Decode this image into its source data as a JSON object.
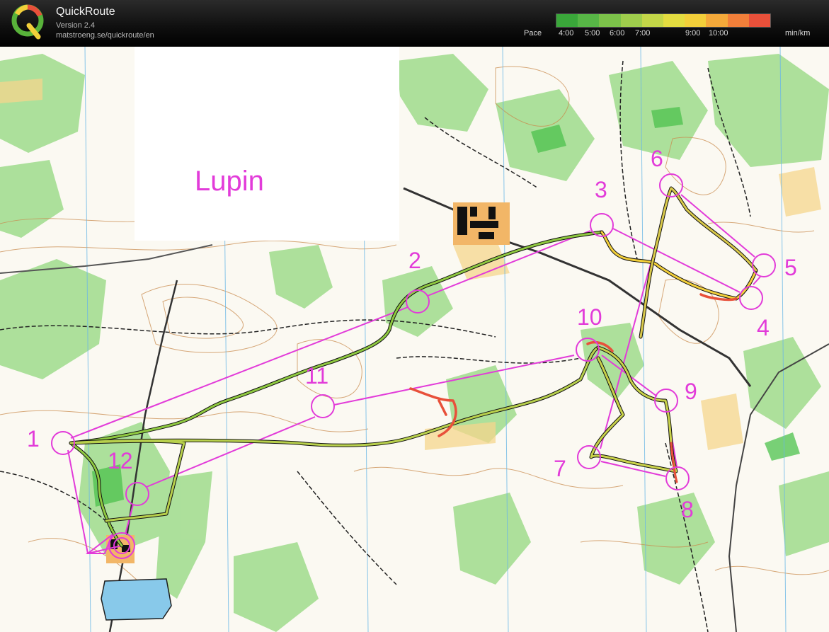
{
  "header": {
    "app_name": "QuickRoute",
    "version": "Version 2.4",
    "url": "matstroeng.se/quickroute/en",
    "logo_letter": "Q"
  },
  "pace_legend": {
    "label": "Pace",
    "ticks": [
      "4:00",
      "5:00",
      "6:00",
      "7:00",
      "9:00",
      "10:00"
    ],
    "unit": "min/km",
    "gradient_colors": [
      "#3aa73a",
      "#57b646",
      "#7cc24a",
      "#9fcd4c",
      "#c3d648",
      "#e3dc40",
      "#f2cf3a",
      "#f4a93a",
      "#f17f3a",
      "#e8503a"
    ]
  },
  "map": {
    "title": "Lupin",
    "route_color": "#e23bd9",
    "control_numbers": {
      "c1": "1",
      "c2": "2",
      "c3": "3",
      "c4": "4",
      "c5": "5",
      "c6": "6",
      "c7": "7",
      "c8": "8",
      "c9": "9",
      "c10": "10",
      "c11": "11",
      "c12": "12"
    }
  }
}
